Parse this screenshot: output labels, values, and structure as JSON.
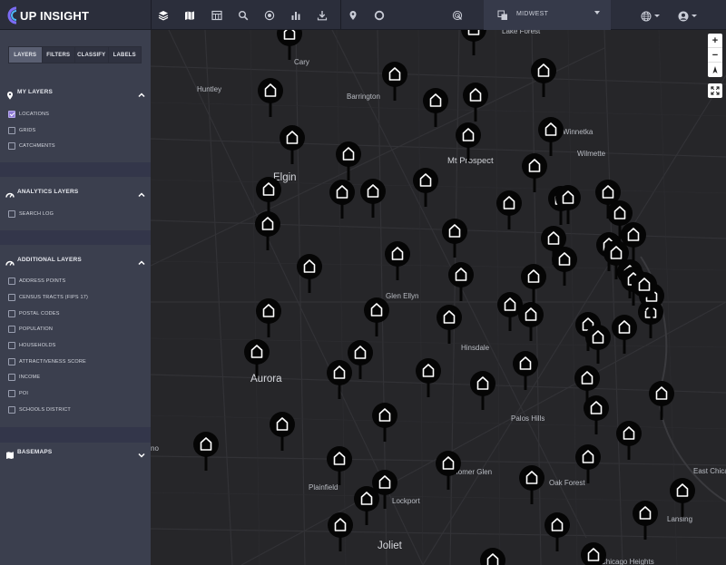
{
  "app": {
    "logo_text": "UP INSIGHT"
  },
  "toolbar": {
    "tools": [
      "layers-icon",
      "map-icon",
      "table-icon",
      "search-icon",
      "target-icon",
      "bar-chart-icon",
      "download-icon",
      "pin-icon",
      "circle-icon",
      "radar-icon"
    ]
  },
  "region_selector": {
    "value": "MIDWEST"
  },
  "header_right": {
    "language": "globe-icon",
    "user": "user-icon"
  },
  "sidebar": {
    "tabs": [
      {
        "label": "LAYERS",
        "active": true
      },
      {
        "label": "FILTERS",
        "active": false
      },
      {
        "label": "CLASSIFY",
        "active": false
      },
      {
        "label": "LABELS",
        "active": false
      }
    ],
    "my_layers": {
      "title": "MY LAYERS",
      "items": [
        {
          "label": "LOCATIONS",
          "checked": true
        },
        {
          "label": "GRIDS",
          "checked": false
        },
        {
          "label": "CATCHMENTS",
          "checked": false
        }
      ]
    },
    "analytics_layers": {
      "title": "ANALYTICS LAYERS",
      "items": [
        {
          "label": "SEARCH LOG",
          "checked": false
        }
      ]
    },
    "additional_layers": {
      "title": "ADDITIONAL LAYERS",
      "items": [
        {
          "label": "ADDRESS POINTS",
          "checked": false
        },
        {
          "label": "CENSUS TRACTS (FIPS 17)",
          "checked": false
        },
        {
          "label": "POSTAL CODES",
          "checked": false
        },
        {
          "label": "POPULATION",
          "checked": false
        },
        {
          "label": "HOUSEHOLDS",
          "checked": false
        },
        {
          "label": "ATTRACTIVENESS SCORE",
          "checked": false
        },
        {
          "label": "INCOME",
          "checked": false
        },
        {
          "label": "POI",
          "checked": false
        },
        {
          "label": "SCHOOLS DISTRICT",
          "checked": false
        }
      ]
    },
    "basemaps": {
      "title": "BASEMAPS"
    }
  },
  "map": {
    "cities": [
      {
        "name": "Lake Forest",
        "size": "small"
      },
      {
        "name": "Cary",
        "size": "small"
      },
      {
        "name": "Huntley",
        "size": "small"
      },
      {
        "name": "Barrington",
        "size": "small"
      },
      {
        "name": "Winnetka",
        "size": "small"
      },
      {
        "name": "Wilmette",
        "size": "small"
      },
      {
        "name": "Mt Prospect",
        "size": "mid"
      },
      {
        "name": "Elgin",
        "size": "big"
      },
      {
        "name": "Glen Ellyn",
        "size": "small"
      },
      {
        "name": "Hinsdale",
        "size": "small"
      },
      {
        "name": "Aurora",
        "size": "big"
      },
      {
        "name": "Palos Hills",
        "size": "small"
      },
      {
        "name": "Homer Glen",
        "size": "small"
      },
      {
        "name": "Oak Forest",
        "size": "small"
      },
      {
        "name": "East Chica",
        "size": "small"
      },
      {
        "name": "Plainfield",
        "size": "small"
      },
      {
        "name": "Lockport",
        "size": "small"
      },
      {
        "name": "Lansing",
        "size": "small"
      },
      {
        "name": "Joliet",
        "size": "big"
      },
      {
        "name": "Chicago Heights",
        "size": "small"
      },
      {
        "name": "no",
        "size": "small"
      }
    ],
    "location_pin_icon": "home-pin-icon",
    "zoom_in": "+",
    "zoom_out": "−",
    "compass": "compass-icon",
    "fullscreen": "fullscreen-icon"
  }
}
